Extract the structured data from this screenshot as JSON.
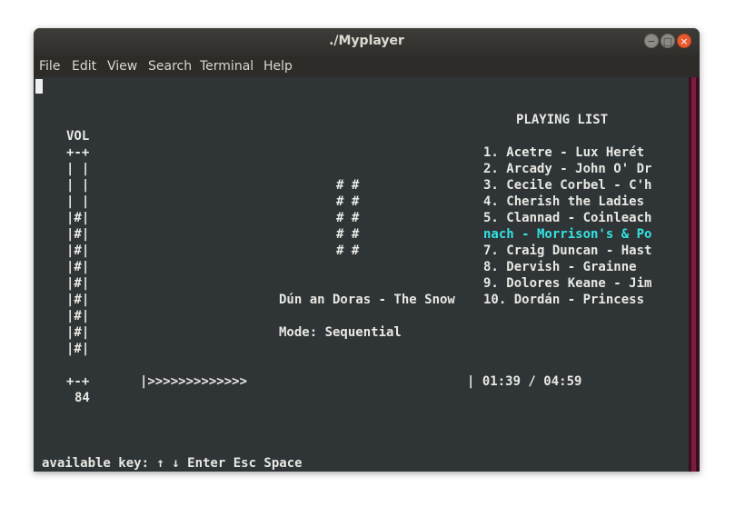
{
  "window": {
    "title": "./Myplayer"
  },
  "window_controls": {
    "minimize": "−",
    "maximize": "□",
    "close": "×"
  },
  "menu": [
    "File",
    "Edit",
    "View",
    "Search",
    "Terminal",
    "Help"
  ],
  "volume": {
    "label": "VOL",
    "rows": [
      "+-+",
      "| |",
      "| |",
      "| |",
      "|#|",
      "|#|",
      "|#|",
      "|#|",
      "|#|",
      "|#|",
      "|#|",
      "|#|",
      "|#|",
      "+-+"
    ],
    "value": "84"
  },
  "visualizer": {
    "rows": [
      "# #",
      "# #",
      "# #",
      "# #",
      "# #"
    ]
  },
  "now_playing": {
    "track": "Dún an Doras - The Snow",
    "mode": "Mode: Sequential"
  },
  "playlist": {
    "heading": "PLAYING LIST",
    "items": [
      "1. Acetre - Lux Herét",
      "2. Arcady - John O' Dr",
      "3. Cecile Corbel - C'h",
      "4. Cherish the Ladies",
      "5. Clannad - Coinleach",
      "nach - Morrison's & Po",
      "7. Craig Duncan - Hast",
      "8. Dervish - Grainne",
      "9. Dolores Keane - Jim",
      "10. Dordán - Princess"
    ],
    "selected_index": 5,
    "selected_color": "#34e2e2"
  },
  "progress": {
    "bar": "|>>>>>>>>>>>>>",
    "time": "| 01:39 / 04:59",
    "elapsed": "01:39",
    "total": "04:59"
  },
  "footer": {
    "keys": "available key: ↑ ↓ Enter Esc Space"
  }
}
